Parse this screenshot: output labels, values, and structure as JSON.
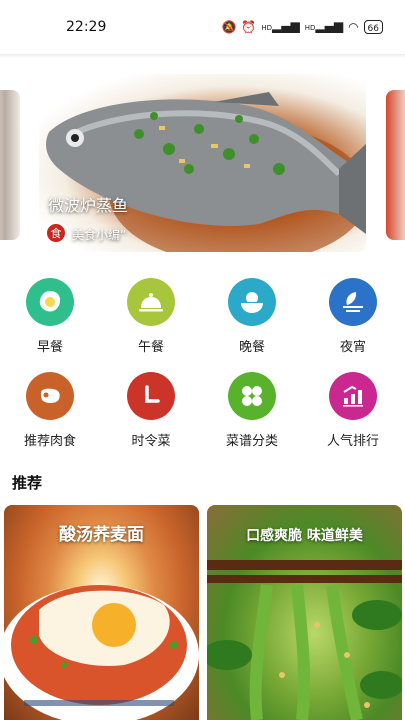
{
  "status_bar": {
    "time": "22:29",
    "battery": "66",
    "signal_label_1": "HD",
    "signal_label_2": "HD"
  },
  "banner": {
    "title": "微波炉蒸鱼",
    "author": "美食小编”",
    "logo_text": "食"
  },
  "categories": [
    {
      "label": "早餐",
      "icon": "fried-egg-icon",
      "color": "#2fbf8c"
    },
    {
      "label": "午餐",
      "icon": "cloche-icon",
      "color": "#a8c63b"
    },
    {
      "label": "晚餐",
      "icon": "bowl-icon",
      "color": "#2aa9c9"
    },
    {
      "label": "夜宵",
      "icon": "moon-icon",
      "color": "#2a73c9"
    },
    {
      "label": "推荐肉食",
      "icon": "steak-icon",
      "color": "#c9622a"
    },
    {
      "label": "时令菜",
      "icon": "clock-icon",
      "color": "#cc3329"
    },
    {
      "label": "菜谱分类",
      "icon": "clover-icon",
      "color": "#59b22c"
    },
    {
      "label": "人气排行",
      "icon": "rank-icon",
      "color": "#c9288f"
    }
  ],
  "recommend": {
    "title": "推荐",
    "cards": [
      {
        "caption": "酸汤荞麦面"
      },
      {
        "caption": "口感爽脆 味道鲜美"
      }
    ]
  }
}
